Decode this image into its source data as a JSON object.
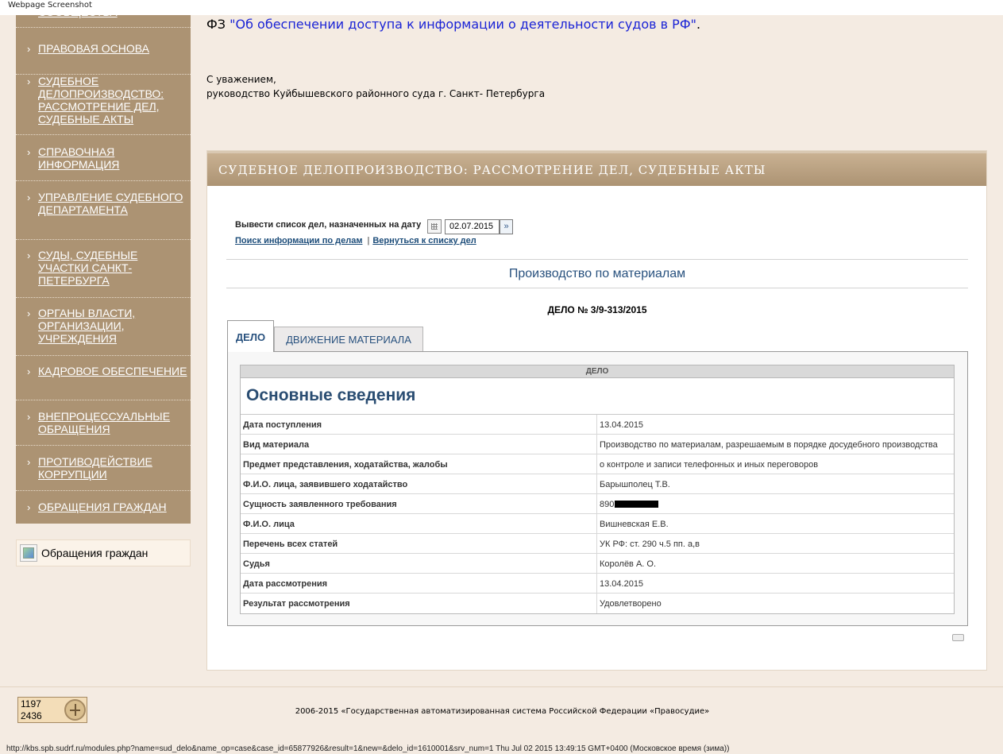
{
  "browser": {
    "caption": "Webpage Screenshot",
    "status_url": "http://kbs.spb.sudrf.ru/modules.php?name=sud_delo&name_op=case&case_id=65877926&result=1&new=&delo_id=1610001&srv_num=1 Thu Jul 02 2015 13:49:15 GMT+0400 (Московское время (зима))"
  },
  "sidebar": {
    "items": [
      {
        "label": "СООБЩЕСТВА"
      },
      {
        "label": "ПРАВОВАЯ ОСНОВА"
      },
      {
        "label": "СУДЕБНОЕ ДЕЛОПРОИЗВОДСТВО: РАССМОТРЕНИЕ ДЕЛ, СУДЕБНЫЕ АКТЫ"
      },
      {
        "label": "СПРАВОЧНАЯ ИНФОРМАЦИЯ"
      },
      {
        "label": "УПРАВЛЕНИЕ СУДЕБНОГО ДЕПАРТАМЕНТА"
      },
      {
        "label": "СУДЫ, СУДЕБНЫЕ УЧАСТКИ САНКТ-ПЕТЕРБУРГА"
      },
      {
        "label": "ОРГАНЫ ВЛАСТИ, ОРГАНИЗАЦИИ, УЧРЕЖДЕНИЯ"
      },
      {
        "label": "КАДРОВОЕ ОБЕСПЕЧЕНИЕ"
      },
      {
        "label": "ВНЕПРОЦЕССУАЛЬНЫЕ ОБРАЩЕНИЯ"
      },
      {
        "label": "ПРОТИВОДЕЙСТВИЕ КОРРУПЦИИ"
      },
      {
        "label": "ОБРАЩЕНИЯ ГРАЖДАН"
      }
    ],
    "arrow": "›",
    "banner_label": "Обращения граждан"
  },
  "intro": {
    "fz_prefix": "ФЗ",
    "fz_link": "\"Об обеспечении доступа к информации о деятельности судов в РФ\"",
    "fz_suffix": ".",
    "regards_line1": "С уважением,",
    "regards_line2": "руководство Куйбышевского районного суда г. Санкт- Петербурга"
  },
  "panel": {
    "title": "СУДЕБНОЕ ДЕЛОПРОИЗВОДСТВО: РАССМОТРЕНИЕ ДЕЛ, СУДЕБНЫЕ АКТЫ",
    "date_label": "Вывести список дел, назначенных на дату",
    "date_value": "02.07.2015",
    "go_symbol": "»",
    "link_search": "Поиск информации по делам",
    "link_separator": "|",
    "link_back": "Вернуться к списку дел",
    "subtitle": "Производство по материалам",
    "case_number": "ДЕЛО № 3/9-313/2015",
    "tabs": [
      {
        "label": "ДЕЛО",
        "active": true
      },
      {
        "label": "ДВИЖЕНИЕ МАТЕРИАЛА",
        "active": false
      }
    ],
    "table": {
      "head": "ДЕЛО",
      "title": "Основные сведения",
      "rows": [
        {
          "key": "Дата поступления",
          "value": "13.04.2015"
        },
        {
          "key": "Вид материала",
          "value": "Производство по материалам, разрешаемым в порядке досудебного производства"
        },
        {
          "key": "Предмет представления, ходатайства, жалобы",
          "value": "о контроле и записи телефонных и иных переговоров"
        },
        {
          "key": "Ф.И.О. лица, заявившего ходатайство",
          "value": "Барышполец Т.В."
        },
        {
          "key": "Сущность заявленного требования",
          "value": "890"
        },
        {
          "key": "Ф.И.О. лица",
          "value": "Вишневская Е.В."
        },
        {
          "key": "Перечень всех статей",
          "value": "УК РФ: ст. 290 ч.5 пп. а,в"
        },
        {
          "key": "Судья",
          "value": "Королёв А. О."
        },
        {
          "key": "Дата рассмотрения",
          "value": "13.04.2015"
        },
        {
          "key": "Результат рассмотрения",
          "value": "Удовлетворено"
        }
      ]
    }
  },
  "footer": {
    "counter_1": "1197",
    "counter_2": "2436",
    "copyright": "2006-2015 «Государственная автоматизированная система Российской Федерации «Правосудие»"
  },
  "colors": {
    "sidebar": "#ac9373",
    "background": "#f4ebe2",
    "link": "#1a23d6",
    "heading_blue": "#28517e"
  },
  "icons": [
    "calendar-icon",
    "go-arrow-icon",
    "print-icon",
    "counter-logo-icon",
    "banner-image-icon"
  ]
}
